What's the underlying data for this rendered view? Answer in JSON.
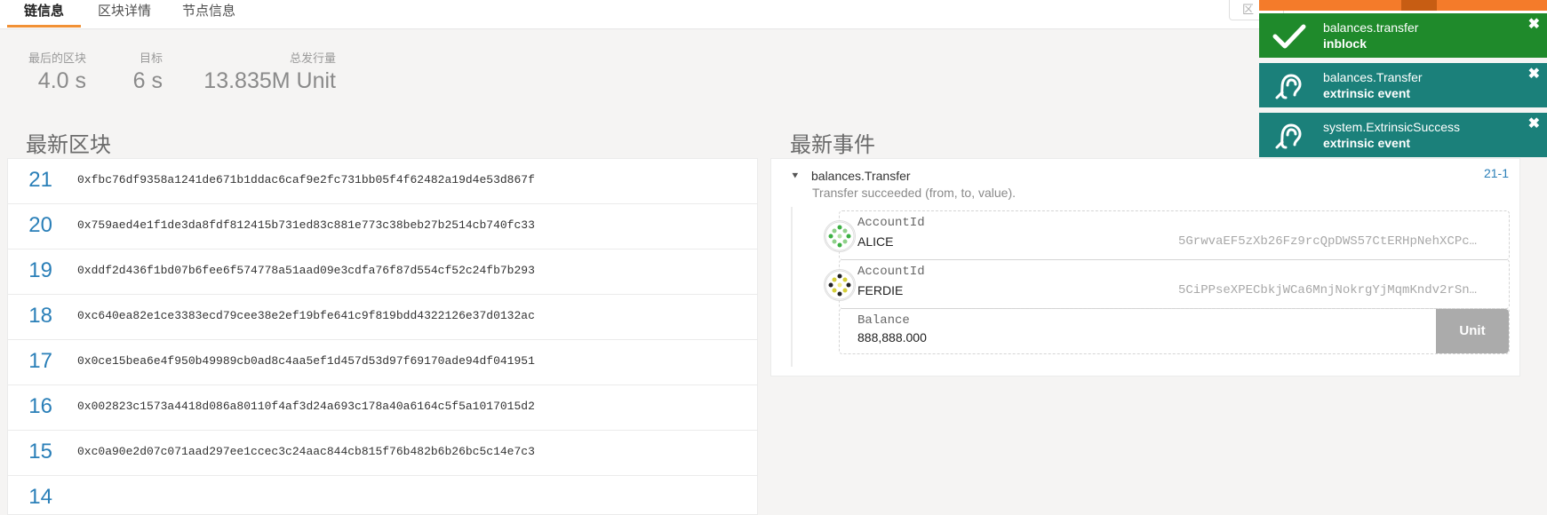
{
  "tabs": [
    {
      "label": "链信息",
      "active": true
    },
    {
      "label": "区块详情",
      "active": false
    },
    {
      "label": "节点信息",
      "active": false
    }
  ],
  "search": {
    "placeholder": "区"
  },
  "stats": [
    {
      "label": "最后的区块",
      "value": "4.0 s"
    },
    {
      "label": "目标",
      "value": "6 s"
    },
    {
      "label": "总发行量",
      "value": "13.835M Unit"
    }
  ],
  "sections": {
    "blocks_title": "最新区块",
    "events_title": "最新事件"
  },
  "blocks": [
    {
      "number": "21",
      "hash": "0xfbc76df9358a1241de671b1ddac6caf9e2fc731bb05f4f62482a19d4e53d867f"
    },
    {
      "number": "20",
      "hash": "0x759aed4e1f1de3da8fdf812415b731ed83c881e773c38beb27b2514cb740fc33"
    },
    {
      "number": "19",
      "hash": "0xddf2d436f1bd07b6fee6f574778a51aad09e3cdfa76f87d554cf52c24fb7b293"
    },
    {
      "number": "18",
      "hash": "0xc640ea82e1ce3383ecd79cee38e2ef19bfe641c9f819bdd4322126e37d0132ac"
    },
    {
      "number": "17",
      "hash": "0x0ce15bea6e4f950b49989cb0ad8c4aa5ef1d457d53d97f69170ade94df041951"
    },
    {
      "number": "16",
      "hash": "0x002823c1573a4418d086a80110f4af3d24a693c178a40a6164c5f5a1017015d2"
    },
    {
      "number": "15",
      "hash": "0xc0a90e2d07c071aad297ee1ccec3c24aac844cb815f76b482b6b26bc5c14e7c3"
    },
    {
      "number": "14",
      "hash": ""
    }
  ],
  "event": {
    "title": "balances.Transfer",
    "description": "Transfer succeeded (from, to, value).",
    "index": "21-1",
    "params": [
      {
        "label": "AccountId",
        "name": "ALICE",
        "address": "5GrwvaEF5zXb26Fz9rcQpDWS57CtERHpNehXCPc…"
      },
      {
        "label": "AccountId",
        "name": "FERDIE",
        "address": "5CiPPseXPECbkjWCa6MnjNokrgYjMqmKndv2rSn…"
      }
    ],
    "balance": {
      "label": "Balance",
      "value": "888,888.000",
      "unit": "Unit"
    }
  },
  "notifications": [
    {
      "title": "balances.transfer",
      "status": "inblock",
      "icon": "check-icon",
      "color": "#1f8a2b"
    },
    {
      "title": "balances.Transfer",
      "status": "extrinsic event",
      "icon": "ear-icon",
      "color": "#1b807a"
    },
    {
      "title": "system.ExtrinsicSuccess",
      "status": "extrinsic event",
      "icon": "ear-icon",
      "color": "#1b807a"
    }
  ],
  "colors": {
    "accent": "#f19135",
    "link": "#2a7fb8",
    "success": "#1f8a2b",
    "event": "#1b807a"
  }
}
